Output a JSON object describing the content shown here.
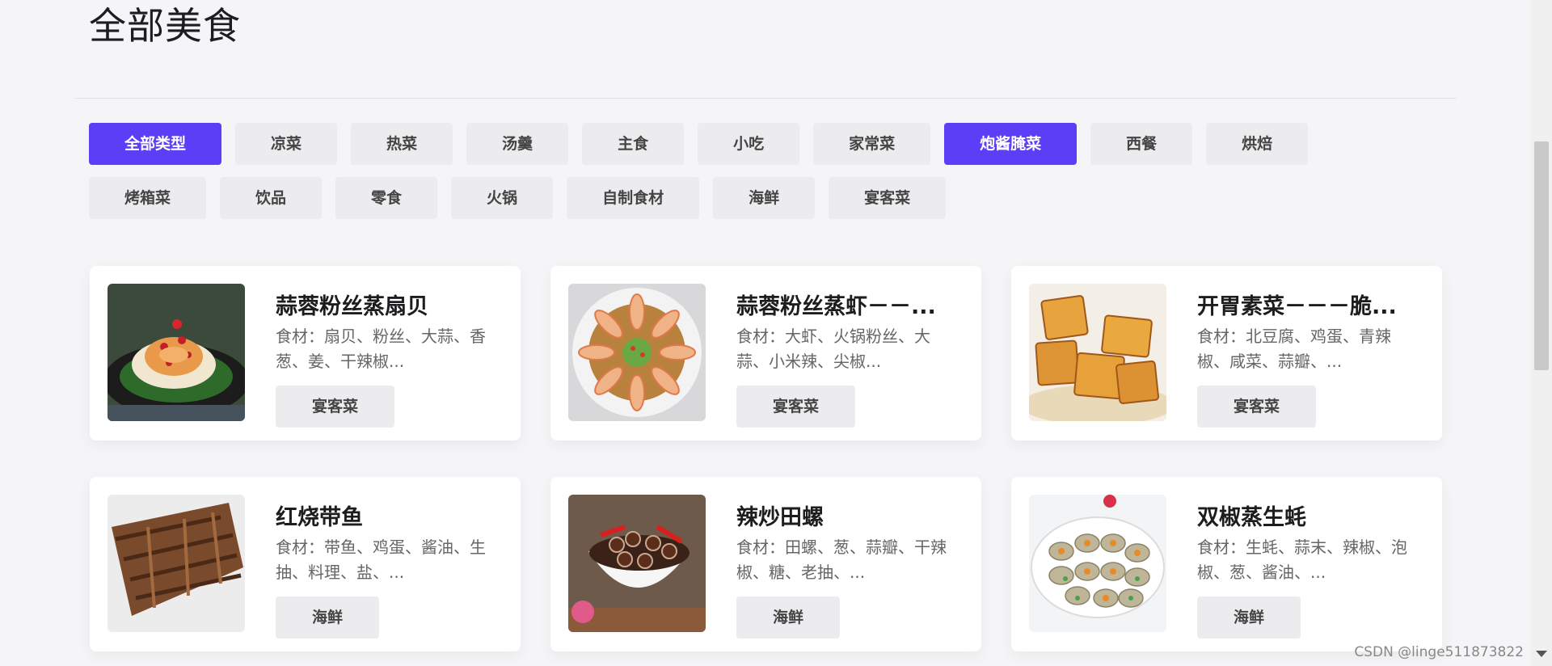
{
  "page": {
    "title": "全部美食"
  },
  "filters": {
    "row1": [
      {
        "label": "全部类型",
        "active": true
      },
      {
        "label": "凉菜",
        "active": false
      },
      {
        "label": "热菜",
        "active": false
      },
      {
        "label": "汤羹",
        "active": false
      },
      {
        "label": "主食",
        "active": false
      },
      {
        "label": "小吃",
        "active": false
      },
      {
        "label": "家常菜",
        "active": false
      },
      {
        "label": "炮酱腌菜",
        "active": true
      },
      {
        "label": "西餐",
        "active": false
      },
      {
        "label": "烘焙",
        "active": false
      }
    ],
    "row2": [
      {
        "label": "烤箱菜",
        "active": false
      },
      {
        "label": "饮品",
        "active": false
      },
      {
        "label": "零食",
        "active": false
      },
      {
        "label": "火锅",
        "active": false
      },
      {
        "label": "自制食材",
        "active": false
      },
      {
        "label": "海鲜",
        "active": false
      },
      {
        "label": "宴客菜",
        "active": false
      }
    ]
  },
  "cards": [
    {
      "title": "蒜蓉粉丝蒸扇贝",
      "desc": "食材：扇贝、粉丝、大蒜、香葱、姜、干辣椒...",
      "tag": "宴客菜",
      "image_icon": "scallop-dish-image"
    },
    {
      "title": "蒜蓉粉丝蒸虾－－...",
      "desc": "食材：大虾、火锅粉丝、大蒜、小米辣、尖椒...",
      "tag": "宴客菜",
      "image_icon": "shrimp-dish-image"
    },
    {
      "title": "开胃素菜－－－脆...",
      "desc": "食材：北豆腐、鸡蛋、青辣椒、咸菜、蒜瓣、...",
      "tag": "宴客菜",
      "image_icon": "tofu-dish-image"
    },
    {
      "title": "红烧带鱼",
      "desc": "食材：带鱼、鸡蛋、酱油、生抽、料理、盐、...",
      "tag": "海鲜",
      "image_icon": "fish-dish-image"
    },
    {
      "title": "辣炒田螺",
      "desc": "食材：田螺、葱、蒜瓣、干辣椒、糖、老抽、...",
      "tag": "海鲜",
      "image_icon": "snail-dish-image"
    },
    {
      "title": "双椒蒸生蚝",
      "desc": "食材：生蚝、蒜末、辣椒、泡椒、葱、酱油、...",
      "tag": "海鲜",
      "image_icon": "oyster-dish-image"
    }
  ],
  "watermark": "CSDN @linge511873822",
  "colors": {
    "accent": "#5b3ef5",
    "chip_bg": "#ececee",
    "background": "#f5f5f7"
  }
}
